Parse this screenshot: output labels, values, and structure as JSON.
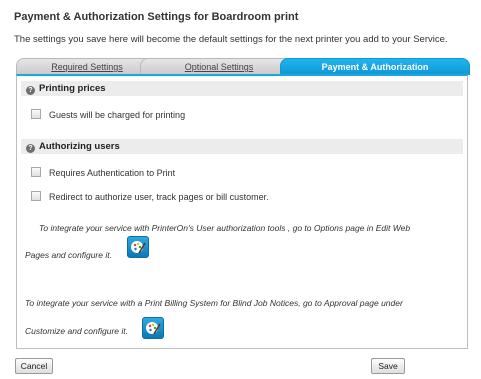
{
  "page": {
    "title": "Payment & Authorization Settings for Boardroom print",
    "description": "The settings you save here will become the default settings for the next printer you add to your Service."
  },
  "tabs": [
    {
      "label": "Required Settings",
      "active": false
    },
    {
      "label": "Optional Settings",
      "active": false
    },
    {
      "label": "Payment & Authorization",
      "active": true
    }
  ],
  "printing_prices": {
    "header": "Printing prices",
    "options": [
      {
        "label": "Guests will be charged for printing",
        "checked": false
      }
    ]
  },
  "authorizing_users": {
    "header": "Authorizing users",
    "options": [
      {
        "label": "Requires Authentication to Print",
        "checked": false
      },
      {
        "label": "Redirect to authorize user, track pages or bill customer.",
        "checked": false
      }
    ],
    "info1_line1": "To integrate your service with PrinterOn's User authorization tools , go to Options page in Edit Web",
    "info1_line2": "Pages and configure it.",
    "info2_line1": "To integrate your service with a Print Billing System for Blind Job Notices, go to Approval page under",
    "info2_line2": "Customize and configure it."
  },
  "icons": {
    "help": "help-circle-icon",
    "configure": "palette-configure-icon"
  },
  "colors": {
    "active_tab": "#1aa6e0",
    "section_header_bg": "#ececec",
    "configure_button": "#0f8ed0"
  },
  "buttons": {
    "cancel": "Cancel",
    "save": "Save"
  }
}
